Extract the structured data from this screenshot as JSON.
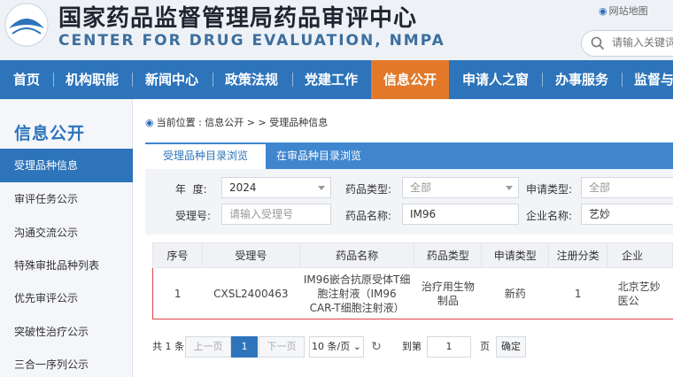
{
  "header": {
    "title_cn": "国家药品监督管理局药品审评中心",
    "title_en": "CENTER FOR DRUG EVALUATION, NMPA",
    "sitemap": "网站地图",
    "search_placeholder": "请输入关键词"
  },
  "nav": [
    "首页",
    "机构职能",
    "新闻中心",
    "政策法规",
    "党建工作",
    "信息公开",
    "申请人之窗",
    "办事服务",
    "监督与"
  ],
  "sidebar": {
    "title": "信息公开",
    "items": [
      "受理品种信息",
      "审评任务公示",
      "沟通交流公示",
      "特殊审批品种列表",
      "优先审评公示",
      "突破性治疗公示",
      "三合一序列公示"
    ]
  },
  "breadcrumb": "当前位置 : 信息公开 > > 受理品种信息",
  "tabs": [
    "受理品种目录浏览",
    "在审品种目录浏览"
  ],
  "filters": {
    "year_label": "年  度:",
    "year_value": "2024",
    "drug_type_label": "药品类型:",
    "drug_type_value": "全部",
    "apply_type_label": "申请类型:",
    "apply_type_value": "全部",
    "accept_no_label": "受理号:",
    "accept_no_placeholder": "请输入受理号",
    "drug_name_label": "药品名称:",
    "drug_name_value": "IM96",
    "company_label": "企业名称:",
    "company_value": "艺妙"
  },
  "table": {
    "headers": [
      "序号",
      "受理号",
      "药品名称",
      "药品类型",
      "申请类型",
      "注册分类",
      "企业"
    ],
    "rows": [
      [
        "1",
        "CXSL2400463",
        "IM96嵌合抗原受体T细胞注射液（IM96 CAR-T细胞注射液）",
        "治疗用生物制品",
        "新药",
        "1",
        "北京艺妙医公"
      ]
    ]
  },
  "pager": {
    "total": "共 1 条",
    "prev": "上一页",
    "current": "1",
    "next": "下一页",
    "per_page": "10 条/页",
    "goto_label": "到第",
    "goto_value": "1",
    "page_unit": "页",
    "confirm": "确定"
  }
}
